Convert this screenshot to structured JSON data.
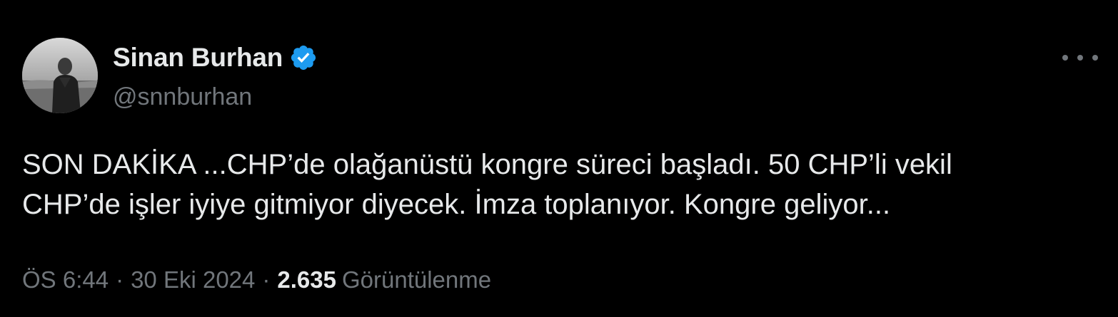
{
  "author": {
    "display_name": "Sinan Burhan",
    "handle": "@snnburhan",
    "verified": true,
    "verified_color": "#1d9bf0"
  },
  "tweet": {
    "text": "SON DAKİKA ...CHP’de olağanüstü kongre süreci başladı. 50 CHP’li vekil\nCHP’de işler iyiye gitmiyor diyecek. İmza toplanıyor. Kongre geliyor..."
  },
  "meta": {
    "time": "ÖS 6:44",
    "separator": "·",
    "date": "30 Eki 2024",
    "views_count": "2.635",
    "views_label": "Görüntülenme"
  },
  "icons": {
    "verified": "verified-badge-icon",
    "more": "more-options-icon"
  },
  "colors": {
    "background": "#000000",
    "primary_text": "#e7e9ea",
    "secondary_text": "#71767b"
  }
}
